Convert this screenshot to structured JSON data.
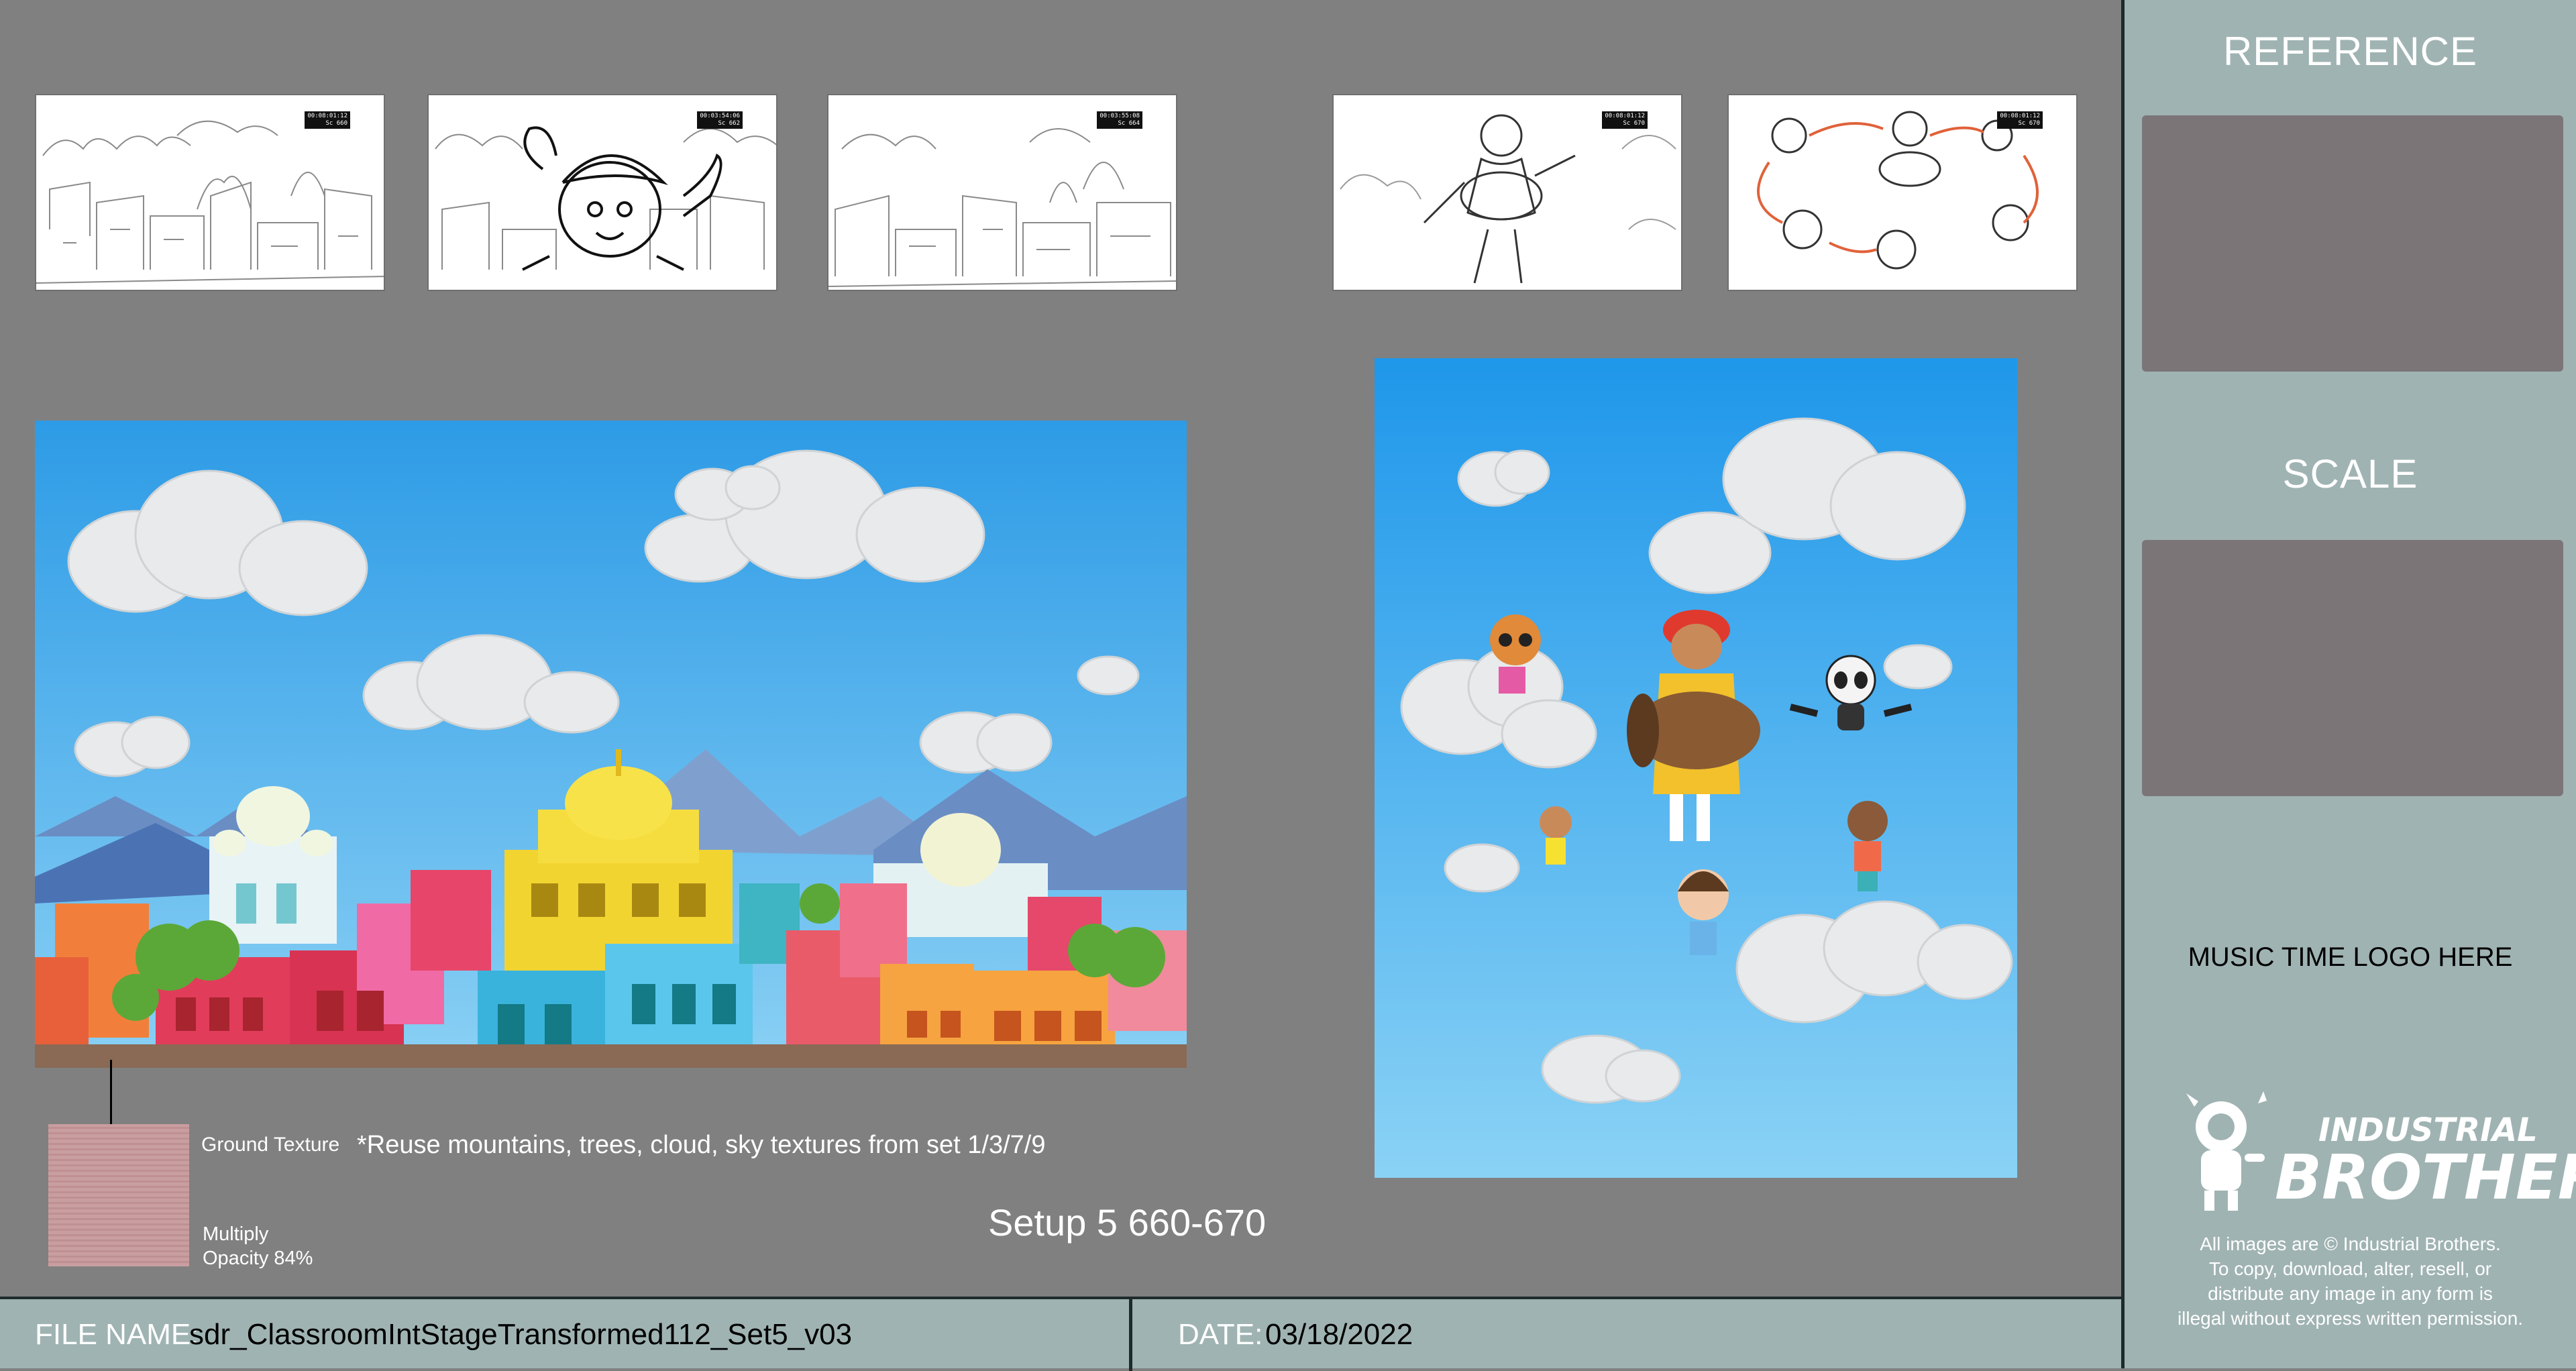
{
  "storyboard": {
    "frames": [
      {
        "timecode_line1": "00:08:01:12",
        "timecode_line2": "Sc 660"
      },
      {
        "timecode_line1": "00:03:54:06",
        "timecode_line2": "Sc 662"
      },
      {
        "timecode_line1": "00:03:55:08",
        "timecode_line2": "Sc 664"
      },
      {
        "timecode_line1": "00:08:01:12",
        "timecode_line2": "Sc 670"
      },
      {
        "timecode_line1": "00:08:01:12",
        "timecode_line2": "Sc 670"
      }
    ]
  },
  "ground_texture": {
    "label": "Ground Texture",
    "blend_line1": "Multiply",
    "blend_line2": "Opacity 84%"
  },
  "note": "*Reuse mountains, trees, cloud, sky textures from set 1/3/7/9",
  "setup_label": "Setup 5 660-670",
  "panel": {
    "reference_title": "REFERENCE",
    "scale_title": "SCALE",
    "logo_placeholder": "MUSIC TIME LOGO HERE",
    "brand_line1": "INDUSTRIAL",
    "brand_line2": "BROTHERS",
    "copyright_lines": [
      "All images are © Industrial Brothers.",
      "To copy, download, alter, resell, or",
      "distribute any image in any form is",
      "illegal without express written permission."
    ]
  },
  "footer": {
    "file_name_label": "FILE NAME:",
    "file_name_value": "sdr_ClassroomIntStageTransformed112_Set5_v03",
    "date_label": "DATE:",
    "date_value": "03/18/2022"
  },
  "colors": {
    "canvas": "#808080",
    "panel": "#9fb3b2",
    "sky": "#4aa8e6",
    "ground_texture": "#c8989a"
  }
}
